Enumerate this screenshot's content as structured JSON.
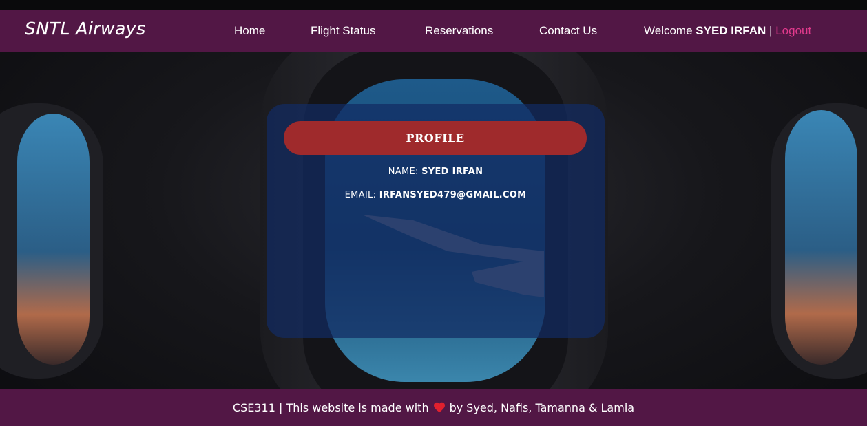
{
  "brand": {
    "name": "SNTL Airways"
  },
  "nav": {
    "items": [
      {
        "label": "Home"
      },
      {
        "label": "Flight Status"
      },
      {
        "label": "Reservations"
      },
      {
        "label": "Contact Us"
      }
    ],
    "welcome_prefix": "Welcome",
    "user_name": "SYED IRFAN",
    "separator": "|",
    "logout_label": "Logout"
  },
  "profile": {
    "header_label": "PROFILE",
    "name_label": "NAME:",
    "name_value": "SYED IRFAN",
    "email_label": "EMAIL:",
    "email_value": "IRFANSYED479@GMAIL.COM"
  },
  "footer": {
    "text_before": "CSE311 | This website is made with",
    "heart_icon": "heart-icon",
    "text_after": "by Syed, Nafis, Tamanna & Lamia"
  },
  "colors": {
    "navbar": "#521745",
    "logout": "#e23a8d",
    "profile_button": "#9f2a2c",
    "card": "#122b62",
    "heart": "#e0202e"
  }
}
